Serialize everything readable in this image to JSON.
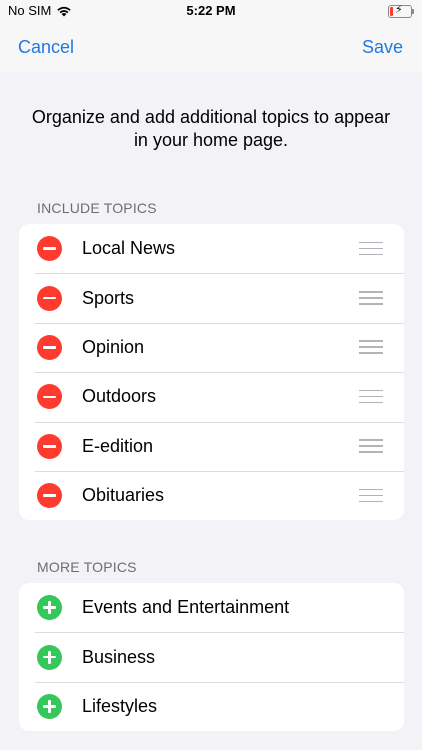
{
  "status_bar": {
    "carrier": "No SIM",
    "time": "5:22 PM",
    "wifi_icon": "wifi-icon",
    "battery_icon": "battery-charging-icon",
    "battery_level": 0.15,
    "battery_color": "#ff3b30"
  },
  "nav": {
    "cancel_label": "Cancel",
    "save_label": "Save",
    "accent_color": "#1f7ae0"
  },
  "intro_text": "Organize and add additional topics to appear in your home page.",
  "include_section": {
    "header": "INCLUDE TOPICS",
    "action_icon": "remove-circle-icon",
    "action_color": "#ff3b30",
    "items": [
      {
        "label": "Local News"
      },
      {
        "label": "Sports"
      },
      {
        "label": "Opinion"
      },
      {
        "label": "Outdoors"
      },
      {
        "label": "E-edition"
      },
      {
        "label": "Obituaries"
      }
    ]
  },
  "more_section": {
    "header": "MORE TOPICS",
    "action_icon": "add-circle-icon",
    "action_color": "#34c759",
    "items": [
      {
        "label": "Events and Entertainment"
      },
      {
        "label": "Business"
      },
      {
        "label": "Lifestyles"
      }
    ]
  }
}
